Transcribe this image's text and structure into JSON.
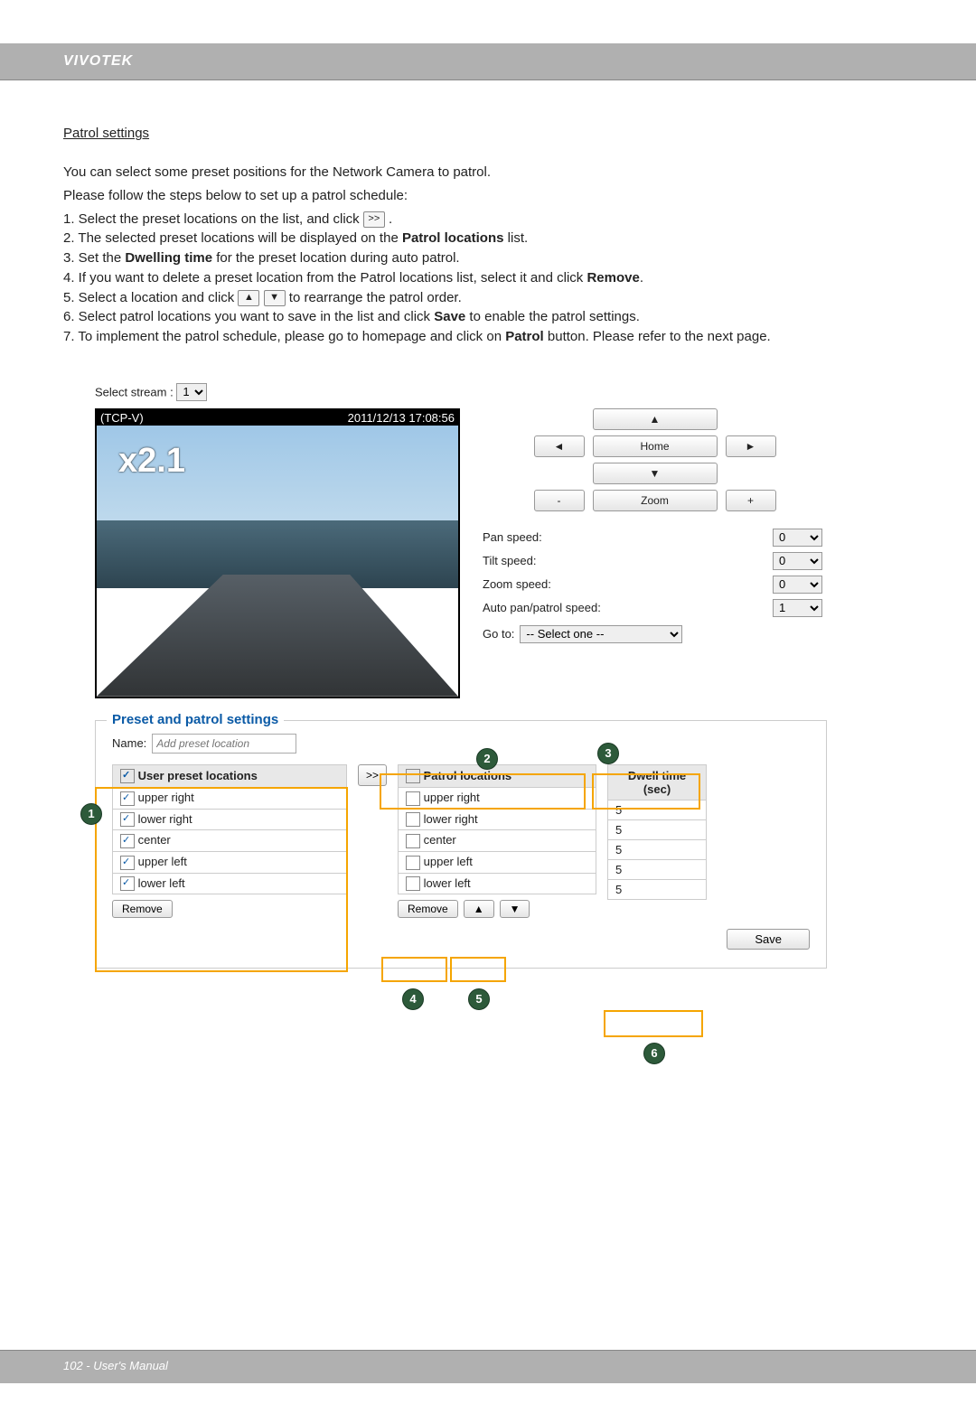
{
  "header": {
    "brand": "VIVOTEK"
  },
  "section_title": "Patrol settings",
  "intro": {
    "line1": "You can select some preset positions for the Network Camera to patrol.",
    "line2": "Please follow the steps below to set up a patrol schedule:"
  },
  "steps": {
    "s1a": "1. Select the preset locations on the list, and click ",
    "s1b": ".",
    "s2a": "2. The selected preset locations will be displayed on the ",
    "s2b": "Patrol locations",
    "s2c": " list.",
    "s3a": "3. Set the ",
    "s3b": "Dwelling time",
    "s3c": " for the preset location during auto patrol.",
    "s4a": "4. If you want to delete a preset location from the Patrol locations list, select it and click ",
    "s4b": "Remove",
    "s4c": ".",
    "s5a": "5. Select a location and click ",
    "s5b": " to rearrange the patrol order.",
    "s6a": "6. Select patrol locations you want to save in the list and click ",
    "s6b": "Save",
    "s6c": " to enable the patrol settings.",
    "s7a": "7. To implement the patrol schedule, please go to homepage and click on ",
    "s7b": "Patrol",
    "s7c": " button. Please refer to the next page."
  },
  "icons": {
    "xfer": ">>",
    "up": "▲",
    "down": "▼",
    "left": "◄",
    "right": "►",
    "plus": "+",
    "minus": "-"
  },
  "stream": {
    "label": "Select stream :",
    "value": "1"
  },
  "video": {
    "protocol": "(TCP-V)",
    "timestamp": "2011/12/13 17:08:56",
    "zoom_overlay": "x2.1"
  },
  "controls": {
    "home": "Home",
    "zoom": "Zoom",
    "pan_speed_label": "Pan speed:",
    "tilt_speed_label": "Tilt speed:",
    "zoom_speed_label": "Zoom speed:",
    "auto_speed_label": "Auto pan/patrol speed:",
    "goto_label": "Go to:",
    "pan_speed": "0",
    "tilt_speed": "0",
    "zoom_speed": "0",
    "auto_speed": "1",
    "goto_value": "-- Select one --"
  },
  "preset_panel": {
    "legend": "Preset and patrol settings",
    "name_label": "Name:",
    "name_placeholder": "Add preset location",
    "user_header": "User preset locations",
    "patrol_header": "Patrol locations",
    "dwell_header": "Dwell time (sec)",
    "remove": "Remove",
    "save": "Save",
    "user_items": [
      "upper right",
      "lower right",
      "center",
      "upper left",
      "lower left"
    ],
    "patrol_items": [
      "upper right",
      "lower right",
      "center",
      "upper left",
      "lower left"
    ],
    "dwell_values": [
      "5",
      "5",
      "5",
      "5",
      "5"
    ]
  },
  "callouts": {
    "c1": "1",
    "c2": "2",
    "c3": "3",
    "c4": "4",
    "c5": "5",
    "c6": "6"
  },
  "footer": {
    "page": "102 - User's Manual"
  }
}
